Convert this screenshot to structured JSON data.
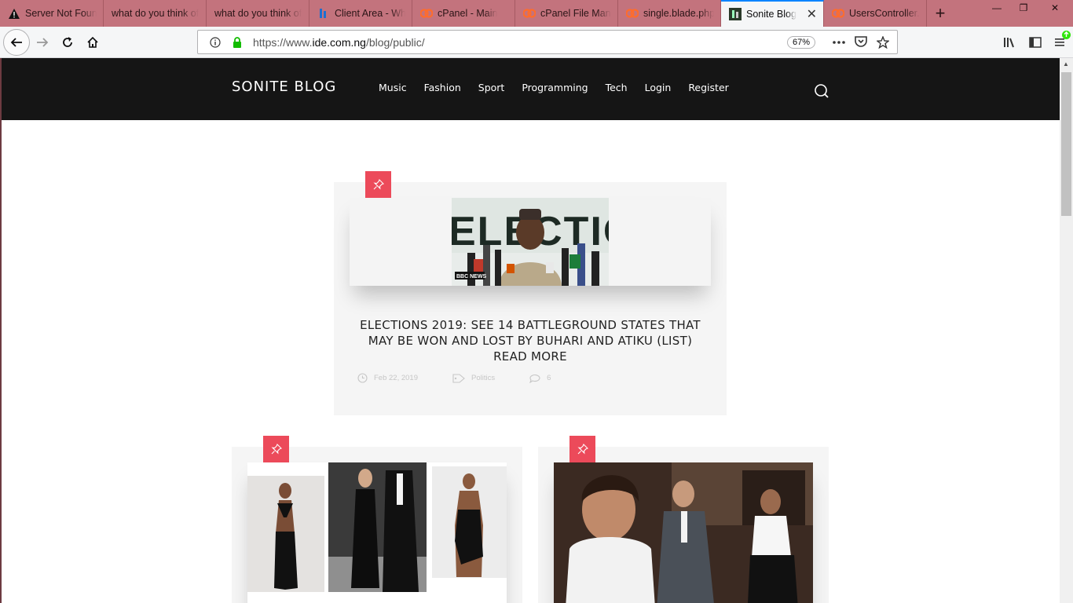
{
  "browser": {
    "tabs": [
      {
        "label": "Server Not Found",
        "icon": "warning-icon",
        "width": 132
      },
      {
        "label": "what do you think of",
        "icon": "none",
        "width": 131
      },
      {
        "label": "what do you think of",
        "icon": "none",
        "width": 131
      },
      {
        "label": "Client Area - Wh",
        "icon": "client-area-icon",
        "width": 131
      },
      {
        "label": "cPanel - Main",
        "icon": "cpanel-icon",
        "width": 131
      },
      {
        "label": "cPanel File Mana",
        "icon": "cpanel-icon",
        "width": 131
      },
      {
        "label": "single.blade.php",
        "icon": "cpanel-icon",
        "width": 131
      },
      {
        "label": "Sonite Blog",
        "icon": "sonite-favicon",
        "width": 131,
        "active": true
      },
      {
        "label": "UsersController.p",
        "icon": "cpanel-icon",
        "width": 131
      }
    ],
    "new_tab_symbol": "+",
    "window_buttons": {
      "minimize": "—",
      "restore": "❐",
      "close": "✕"
    },
    "url_prefix": "https://www.",
    "url_domain": "ide.com.ng",
    "url_path": "/blog/public/",
    "zoom": "67%",
    "tab_close_symbol": "✕"
  },
  "site": {
    "brand": "SONITE BLOG",
    "nav": [
      "Music",
      "Fashion",
      "Sport",
      "Programming",
      "Tech",
      "Login",
      "Register"
    ]
  },
  "posts": [
    {
      "title_line1": "ELECTIONS 2019: SEE 14 BATTLEGROUND STATES THAT",
      "title_line2": "MAY BE WON AND LOST BY BUHARI AND ATIKU (LIST)",
      "read_more": "READ MORE",
      "date": "Feb 22, 2019",
      "category": "Politics",
      "comments": "6",
      "image_caption_text": "ELECTIO",
      "image_logo": "BBC NEWS"
    }
  ],
  "colors": {
    "tabstrip": "#c3737d",
    "site_header": "#151515",
    "accent_pin": "#ec4a5a",
    "active_tab_line": "#0a84ff"
  }
}
